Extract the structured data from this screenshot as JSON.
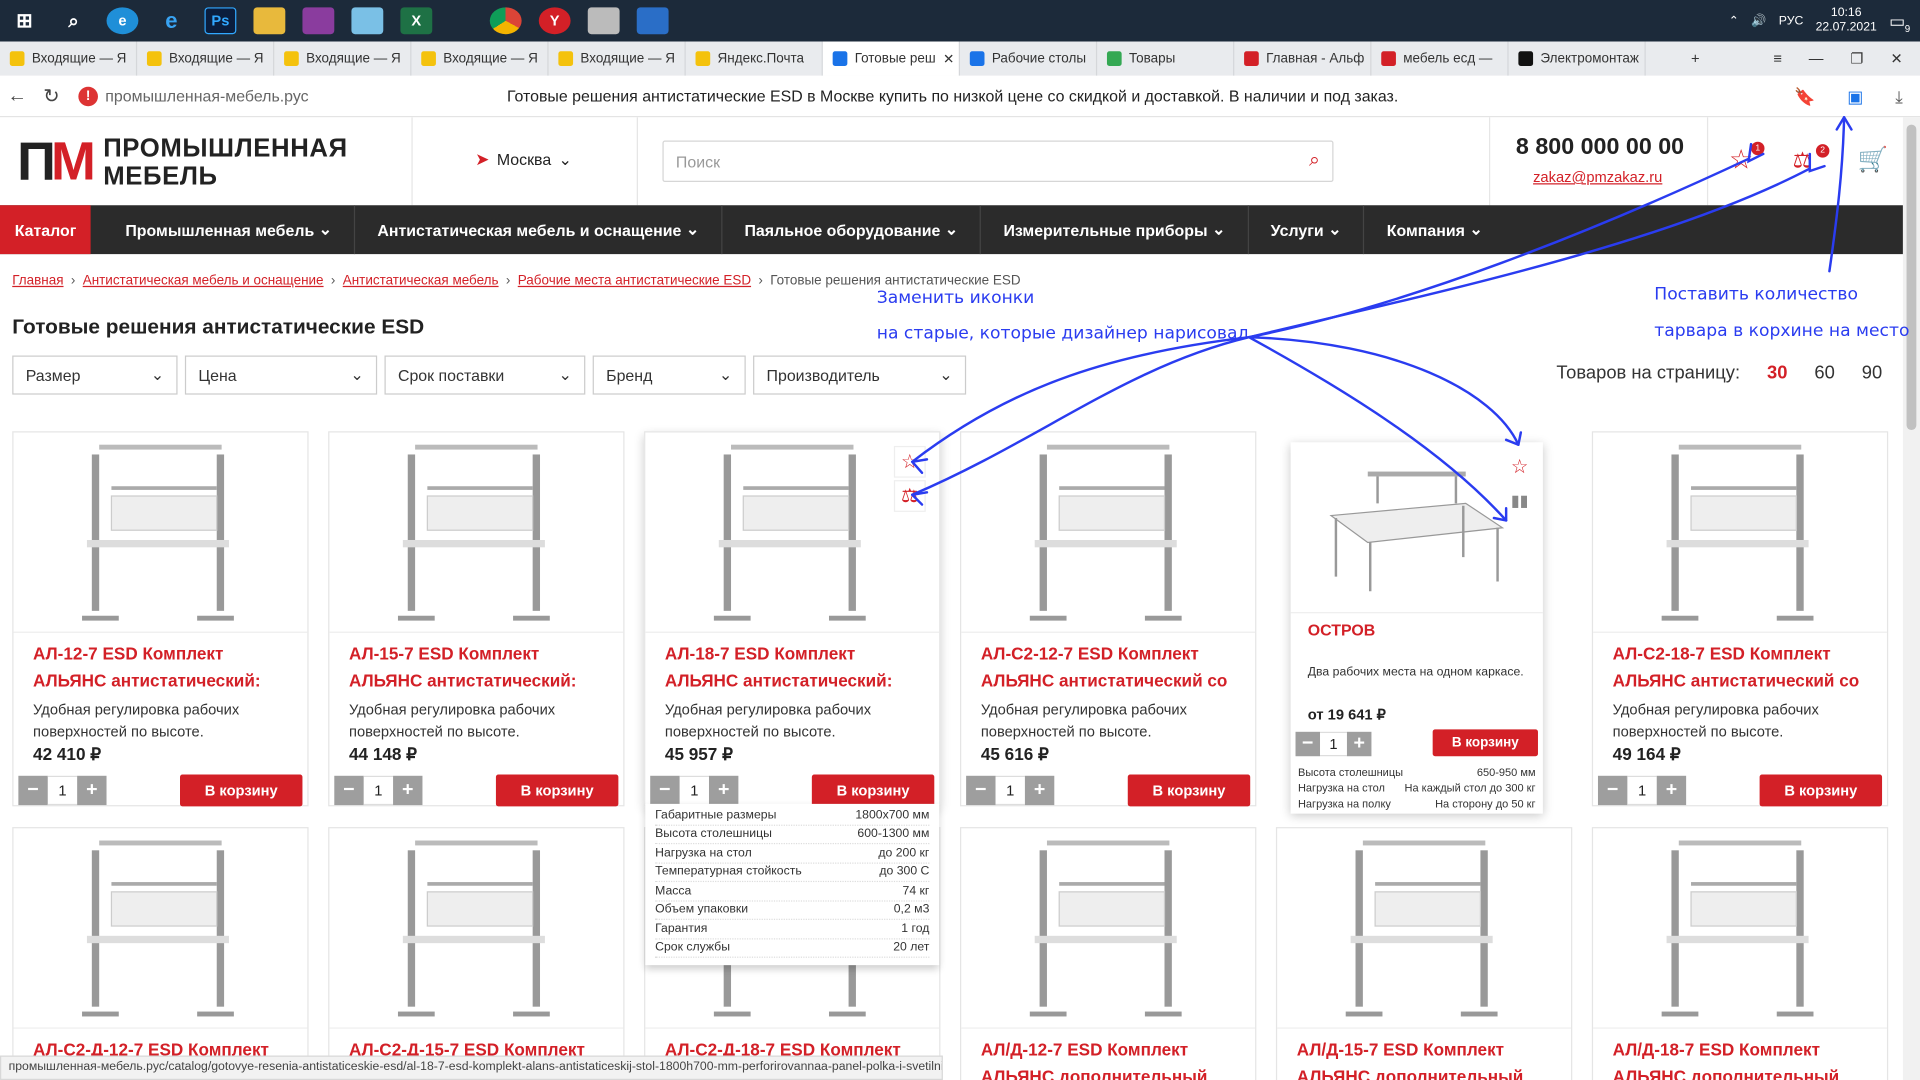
{
  "taskbar": {
    "icons": [
      "windows-start-icon",
      "search-icon",
      "edge-icon",
      "ie-icon",
      "photoshop-icon",
      "explorer-icon",
      "winrar-icon",
      "notepad-icon",
      "excel-icon",
      "chrome-icon",
      "yandex-browser-icon",
      "archive-icon",
      "app-icon"
    ],
    "lang": "РУС",
    "time": "10:16",
    "date": "22.07.2021",
    "notifications": "9"
  },
  "tabs": [
    {
      "label": "Входящие — Я",
      "fav": "#f4c20d"
    },
    {
      "label": "Входящие — Я",
      "fav": "#f4c20d"
    },
    {
      "label": "Входящие — Я",
      "fav": "#f4c20d"
    },
    {
      "label": "Входящие — Я",
      "fav": "#f4c20d"
    },
    {
      "label": "Входящие — Я",
      "fav": "#f4c20d"
    },
    {
      "label": "Яндекс.Почта",
      "fav": "#f4c20d"
    },
    {
      "label": "Готовые реш",
      "fav": "#1a73e8",
      "active": true
    },
    {
      "label": "Рабочие столы",
      "fav": "#1a73e8"
    },
    {
      "label": "Товары",
      "fav": "#34a853"
    },
    {
      "label": "Главная - Альф",
      "fav": "#d32027"
    },
    {
      "label": "мебель есд —",
      "fav": "#d32027"
    },
    {
      "label": "Электромонтаж",
      "fav": "#111111"
    }
  ],
  "address": {
    "url": "промышленная-мебель.рус",
    "page_title": "Готовые решения антистатические ESD в Москве купить по низкой цене со скидкой и доставкой. В наличии и под заказ."
  },
  "header": {
    "logo_mark": "ПМ",
    "logo_line1": "ПРОМЫШЛЕННАЯ",
    "logo_line2": "МЕБЕЛЬ",
    "city": "Москва",
    "search_placeholder": "Поиск",
    "phone": "8 800 000 00 00",
    "email": "zakaz@pmzakaz.ru",
    "favorites_count": "1",
    "compare_count": "2"
  },
  "menu": {
    "catalog": "Каталог",
    "items": [
      "Промышленная мебель",
      "Антистатическая мебель и оснащение",
      "Паяльное оборудование",
      "Измерительные приборы",
      "Услуги",
      "Компания"
    ]
  },
  "breadcrumbs": [
    "Главная",
    "Антистатическая мебель и оснащение",
    "Антистатическая мебель",
    "Рабочие места антистатические ESD",
    "Готовые решения антистатические ESD"
  ],
  "page_heading": "Готовые решения антистатические ESD",
  "filters": [
    "Размер",
    "Цена",
    "Срок поставки",
    "Бренд",
    "Производитель"
  ],
  "per_page": {
    "label": "Товаров на страницу:",
    "options": [
      "30",
      "60",
      "90"
    ],
    "selected": "30"
  },
  "cart_label": "В корзину",
  "products_row1": [
    {
      "name": "АЛ-12-7 ESD Комплект АЛЬЯНС антистатический:",
      "desc": "Удобная регулировка рабочих поверхностей по высоте.",
      "price": "42 410 ₽",
      "qty": "1"
    },
    {
      "name": "АЛ-15-7 ESD Комплект АЛЬЯНС антистатический:",
      "desc": "Удобная регулировка рабочих поверхностей по высоте.",
      "price": "44 148 ₽",
      "qty": "1"
    },
    {
      "name": "АЛ-18-7 ESD Комплект АЛЬЯНС антистатический:",
      "desc": "Удобная регулировка рабочих поверхностей по высоте.",
      "price": "45 957 ₽",
      "qty": "1"
    },
    {
      "name": "АЛ-С2-12-7 ESD Комплект АЛЬЯНС антистатический со",
      "desc": "Удобная регулировка рабочих поверхностей по высоте.",
      "price": "45 616 ₽",
      "qty": "1"
    },
    {
      "name": "",
      "desc": "",
      "price": "",
      "qty": ""
    },
    {
      "name": "АЛ-С2-18-7 ESD Комплект АЛЬЯНС антистатический со",
      "desc": "Удобная регулировка рабочих поверхностей по высоте.",
      "price": "49 164 ₽",
      "qty": "1"
    }
  ],
  "products_row2": [
    "АЛ-С2-Д-12-7 ESD Комплект",
    "АЛ-С2-Д-15-7 ESD Комплект",
    "АЛ-С2-Д-18-7 ESD Комплект",
    "АЛ/Д-12-7 ESD Комплект АЛЬЯНС дополнительный",
    "АЛ/Д-15-7 ESD Комплект АЛЬЯНС дополнительный",
    "АЛ/Д-18-7 ESD Комплект АЛЬЯНС дополнительный"
  ],
  "specs": [
    [
      "Габаритные размеры",
      "1800х700 мм"
    ],
    [
      "Высота столешницы",
      "600-1300 мм"
    ],
    [
      "Нагрузка на стол",
      "до 200  кг"
    ],
    [
      "Температурная стойкость",
      "до 300 С"
    ],
    [
      "Масса",
      "74 кг"
    ],
    [
      "Объем упаковки",
      "0,2 м3"
    ],
    [
      "Гарантия",
      "1 год"
    ],
    [
      "Срок службы",
      "20  лет"
    ]
  ],
  "island": {
    "name": "ОСТРОВ",
    "desc": "Два рабочих места на одном каркасе.",
    "price": "от 19 641 ₽",
    "qty": "1",
    "specs": [
      [
        "Высота столешницы",
        "650-950 мм"
      ],
      [
        "Нагрузка на стол",
        "На каждый стол до 300  кг"
      ],
      [
        "Нагрузка на полку",
        "На сторону до 50 кг"
      ]
    ]
  },
  "status_url": "промышленная-мебель.рус/catalog/gotovye-resenia-antistaticeskie-esd/al-18-7-esd-komplekt-alans-antistaticeskij-stol-1800h700-mm-perforirovannaa-panel-polka-i-svetilnik",
  "annotations": {
    "note1_line1": "Заменить иконки",
    "note1_line2": "на старые, которые дизайнер нарисовал",
    "note2_line1": "Поставить количество",
    "note2_line2": "тарвара в корхине на место"
  },
  "colors": {
    "brand": "#d32027",
    "menu_bg": "#2b2b2b",
    "annotation": "#2a3cf0"
  }
}
